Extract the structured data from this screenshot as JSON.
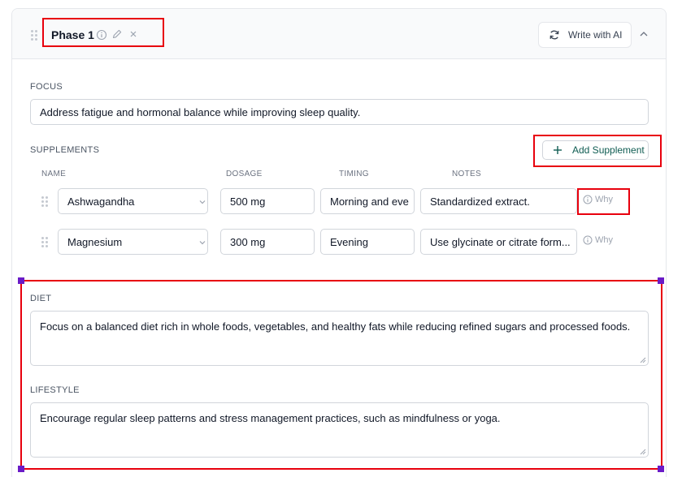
{
  "header": {
    "phase_title": "Phase 1",
    "ai_button_label": "Write with AI"
  },
  "focus": {
    "label": "FOCUS",
    "value": "Address fatigue and hormonal balance while improving sleep quality."
  },
  "supplements": {
    "label": "SUPPLEMENTS",
    "add_button_label": "Add Supplement",
    "columns": {
      "name": "NAME",
      "dosage": "DOSAGE",
      "timing": "TIMING",
      "notes": "NOTES"
    },
    "why_label": "Why",
    "rows": [
      {
        "name": "Ashwagandha",
        "dosage": "500 mg",
        "timing": "Morning and eve",
        "notes": "Standardized extract."
      },
      {
        "name": "Magnesium",
        "dosage": "300 mg",
        "timing": "Evening",
        "notes": "Use glycinate or citrate form..."
      }
    ]
  },
  "diet": {
    "label": "DIET",
    "value": "Focus on a balanced diet rich in whole foods, vegetables, and healthy fats while reducing refined sugars and processed foods."
  },
  "lifestyle": {
    "label": "LIFESTYLE",
    "value": "Encourage regular sleep patterns and stress management practices, such as mindfulness or yoga."
  },
  "colors": {
    "highlight": "#e8000d",
    "selection_handle": "#6a1bc7",
    "accent_text": "#0f5c52"
  },
  "icons": [
    "drag-handle-icon",
    "info-icon",
    "pencil-icon",
    "close-icon",
    "refresh-icon",
    "chevron-up-icon",
    "plus-icon",
    "chevron-down-icon",
    "resize-handle-icon"
  ]
}
